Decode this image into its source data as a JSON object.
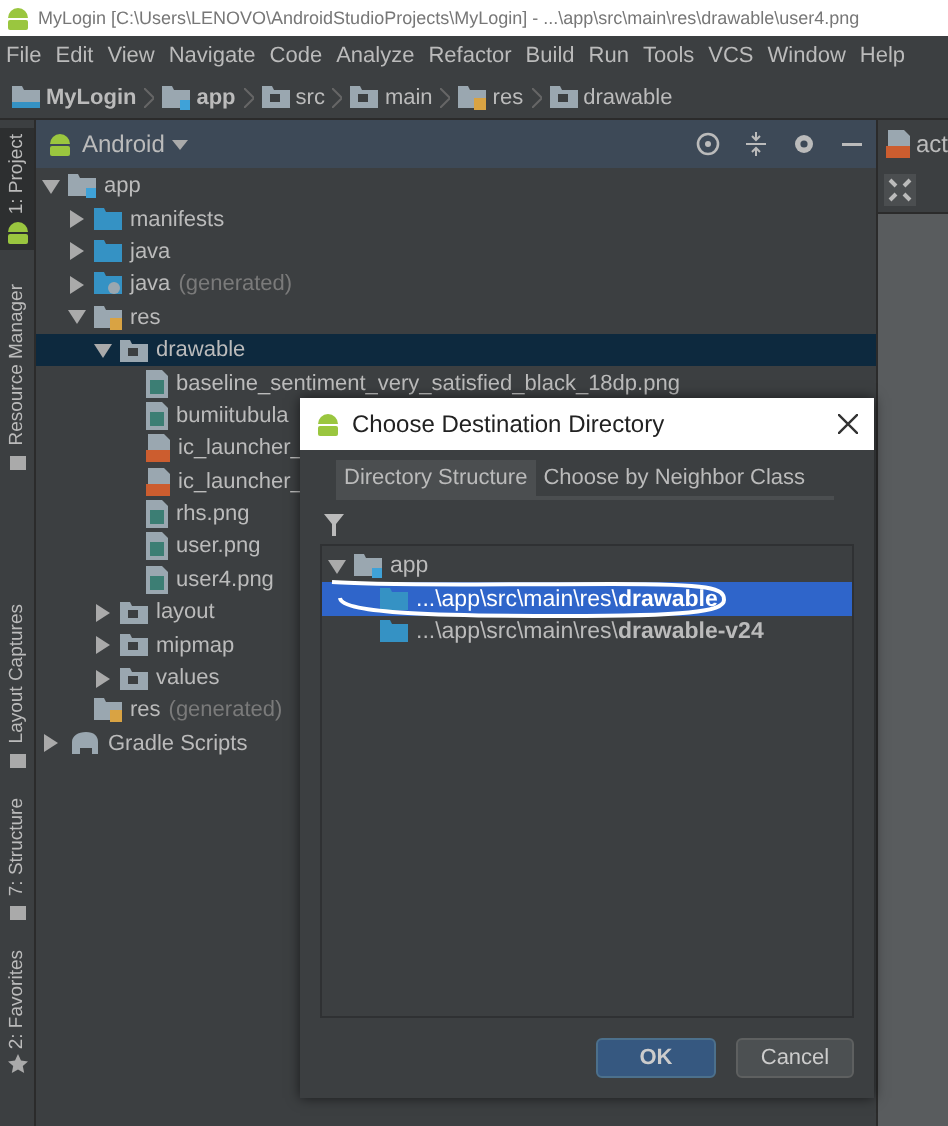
{
  "window": {
    "title": "MyLogin [C:\\Users\\LENOVO\\AndroidStudioProjects\\MyLogin] - ...\\app\\src\\main\\res\\drawable\\user4.png"
  },
  "menu": [
    "File",
    "Edit",
    "View",
    "Navigate",
    "Code",
    "Analyze",
    "Refactor",
    "Build",
    "Run",
    "Tools",
    "VCS",
    "Window",
    "Help"
  ],
  "breadcrumb": [
    {
      "label": "MyLogin",
      "kind": "project"
    },
    {
      "label": "app",
      "kind": "module"
    },
    {
      "label": "src",
      "kind": "folder"
    },
    {
      "label": "main",
      "kind": "folder"
    },
    {
      "label": "res",
      "kind": "res"
    },
    {
      "label": "drawable",
      "kind": "folder"
    }
  ],
  "tool_tabs": [
    {
      "label": "1: Project",
      "selected": true,
      "kind": "android"
    },
    {
      "label": "Resource Manager",
      "selected": false,
      "kind": "res"
    },
    {
      "label": "Layout Captures",
      "selected": false,
      "kind": "capture"
    },
    {
      "label": "7: Structure",
      "selected": false,
      "kind": "structure"
    },
    {
      "label": "2: Favorites",
      "selected": false,
      "kind": "star"
    }
  ],
  "project_panel": {
    "view": "Android",
    "tree": [
      {
        "label": "app",
        "kind": "module",
        "expanded": true,
        "selected": false,
        "children": [
          {
            "label": "manifests",
            "kind": "folder",
            "expanded": false,
            "selected": false
          },
          {
            "label": "java",
            "kind": "folder",
            "expanded": false,
            "selected": false
          },
          {
            "label": "java",
            "suffix": "(generated)",
            "kind": "gen",
            "expanded": false,
            "selected": false
          },
          {
            "label": "res",
            "kind": "res",
            "expanded": true,
            "selected": false,
            "children": [
              {
                "label": "drawable",
                "kind": "plain",
                "expanded": true,
                "selected": true,
                "children": [
                  {
                    "label": "baseline_sentiment_very_satisfied_black_18dp.png",
                    "kind": "file",
                    "selected": false
                  },
                  {
                    "label": "bumiitubula",
                    "kind": "file",
                    "selected": false
                  },
                  {
                    "label": "ic_launcher_",
                    "kind": "xml",
                    "selected": false
                  },
                  {
                    "label": "ic_launcher_",
                    "kind": "xml",
                    "selected": false
                  },
                  {
                    "label": "rhs.png",
                    "kind": "file",
                    "selected": false
                  },
                  {
                    "label": "user.png",
                    "kind": "file",
                    "selected": false
                  },
                  {
                    "label": "user4.png",
                    "kind": "file",
                    "selected": false
                  }
                ]
              },
              {
                "label": "layout",
                "kind": "plain",
                "expanded": false,
                "selected": false
              },
              {
                "label": "mipmap",
                "kind": "plain",
                "expanded": false,
                "selected": false
              },
              {
                "label": "values",
                "kind": "plain",
                "expanded": false,
                "selected": false
              }
            ]
          },
          {
            "label": "res",
            "suffix": "(generated)",
            "kind": "res",
            "selected": false
          }
        ]
      },
      {
        "label": "Gradle Scripts",
        "kind": "gradle",
        "expanded": false,
        "selected": false
      }
    ]
  },
  "editor_tab": {
    "label": "act"
  },
  "dialog": {
    "title": "Choose Destination Directory",
    "tabs": [
      {
        "label": "Directory Structure",
        "selected": true
      },
      {
        "label": "Choose by Neighbor Class",
        "selected": false
      }
    ],
    "tree": [
      {
        "label": "app",
        "kind": "module",
        "expanded": true,
        "selected": false,
        "children": [
          {
            "label": "...\\app\\src\\main\\res\\**drawable**",
            "kind": "folder",
            "selected": true
          },
          {
            "label": "...\\app\\src\\main\\res\\**drawable-v24**",
            "kind": "folder",
            "selected": false
          }
        ]
      }
    ],
    "buttons": [
      {
        "label": "OK",
        "kind": "primary"
      },
      {
        "label": "Cancel",
        "kind": "secondary"
      }
    ]
  }
}
